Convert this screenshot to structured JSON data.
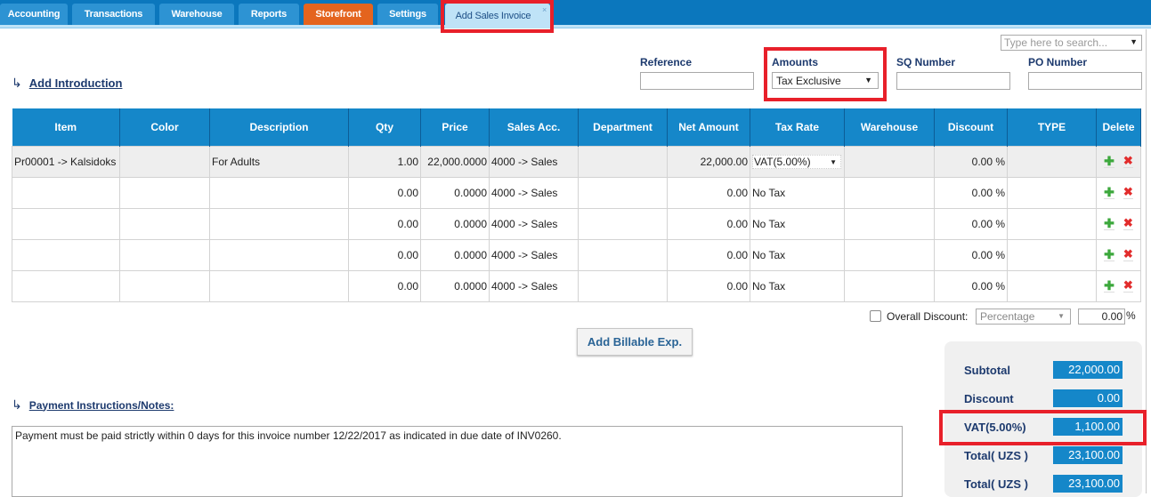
{
  "tabs": [
    {
      "label": "Accounting",
      "color": "#2d93d3"
    },
    {
      "label": "Transactions",
      "color": "#2d93d3"
    },
    {
      "label": "Warehouse",
      "color": "#2d93d3"
    },
    {
      "label": "Reports",
      "color": "#2d93d3"
    },
    {
      "label": "Storefront",
      "color": "#e4641e"
    },
    {
      "label": "Settings",
      "color": "#2d93d3"
    },
    {
      "label": "Add Sales Invoice",
      "color": "#bfe3f7",
      "active": true,
      "close": "×"
    }
  ],
  "header": {
    "search_placeholder": "Type here to search...",
    "reference_label": "Reference",
    "reference_value": "",
    "amounts_label": "Amounts",
    "amounts_value": "Tax Exclusive",
    "sq_label": "SQ Number",
    "sq_value": "",
    "po_label": "PO Number",
    "po_value": ""
  },
  "add_introduction": "Add Introduction",
  "table": {
    "columns": [
      "Item",
      "Color",
      "Description",
      "Qty",
      "Price",
      "Sales Acc.",
      "Department",
      "Net Amount",
      "Tax Rate",
      "Warehouse",
      "Discount",
      "TYPE",
      "Delete"
    ],
    "rows": [
      {
        "item": "Pr00001 -> Kalsidoks",
        "color": "",
        "description": "For Adults",
        "qty": "1.00",
        "price": "22,000.0000",
        "sales_acc": "4000 -> Sales",
        "department": "",
        "net_amount": "22,000.00",
        "tax_rate": "VAT(5.00%)",
        "warehouse": "",
        "discount": "0.00 %",
        "type": ""
      },
      {
        "item": "",
        "color": "",
        "description": "",
        "qty": "0.00",
        "price": "0.0000",
        "sales_acc": "4000 -> Sales",
        "department": "",
        "net_amount": "0.00",
        "tax_rate": "No Tax",
        "warehouse": "",
        "discount": "0.00 %",
        "type": ""
      },
      {
        "item": "",
        "color": "",
        "description": "",
        "qty": "0.00",
        "price": "0.0000",
        "sales_acc": "4000 -> Sales",
        "department": "",
        "net_amount": "0.00",
        "tax_rate": "No Tax",
        "warehouse": "",
        "discount": "0.00 %",
        "type": ""
      },
      {
        "item": "",
        "color": "",
        "description": "",
        "qty": "0.00",
        "price": "0.0000",
        "sales_acc": "4000 -> Sales",
        "department": "",
        "net_amount": "0.00",
        "tax_rate": "No Tax",
        "warehouse": "",
        "discount": "0.00 %",
        "type": ""
      },
      {
        "item": "",
        "color": "",
        "description": "",
        "qty": "0.00",
        "price": "0.0000",
        "sales_acc": "4000 -> Sales",
        "department": "",
        "net_amount": "0.00",
        "tax_rate": "No Tax",
        "warehouse": "",
        "discount": "0.00 %",
        "type": ""
      }
    ],
    "row_actions": {
      "add_icon": "plus-icon",
      "delete_icon": "delete-x-icon"
    }
  },
  "overall_discount": {
    "label": "Overall Discount:",
    "checked": false,
    "type": "Percentage",
    "value": "0.00",
    "unit": "%"
  },
  "add_billable_label": "Add Billable Exp.",
  "payment_notes": {
    "label": "Payment Instructions/Notes:",
    "text": "Payment must be paid strictly within 0 days for this invoice number 12/22/2017 as indicated in due date of INV0260."
  },
  "totals": [
    {
      "label": "Subtotal",
      "value": "22,000.00"
    },
    {
      "label": "Discount",
      "value": "0.00"
    },
    {
      "label": "VAT(5.00%)",
      "value": "1,100.00"
    },
    {
      "label": "Total( UZS )",
      "value": "23,100.00"
    },
    {
      "label": "Total( UZS )",
      "value": "23,100.00"
    }
  ],
  "colors": {
    "header_blue": "#1587c9",
    "topbar_blue": "#0b77bd",
    "highlight_red": "#e8202a",
    "storefront_orange": "#e4641e"
  }
}
